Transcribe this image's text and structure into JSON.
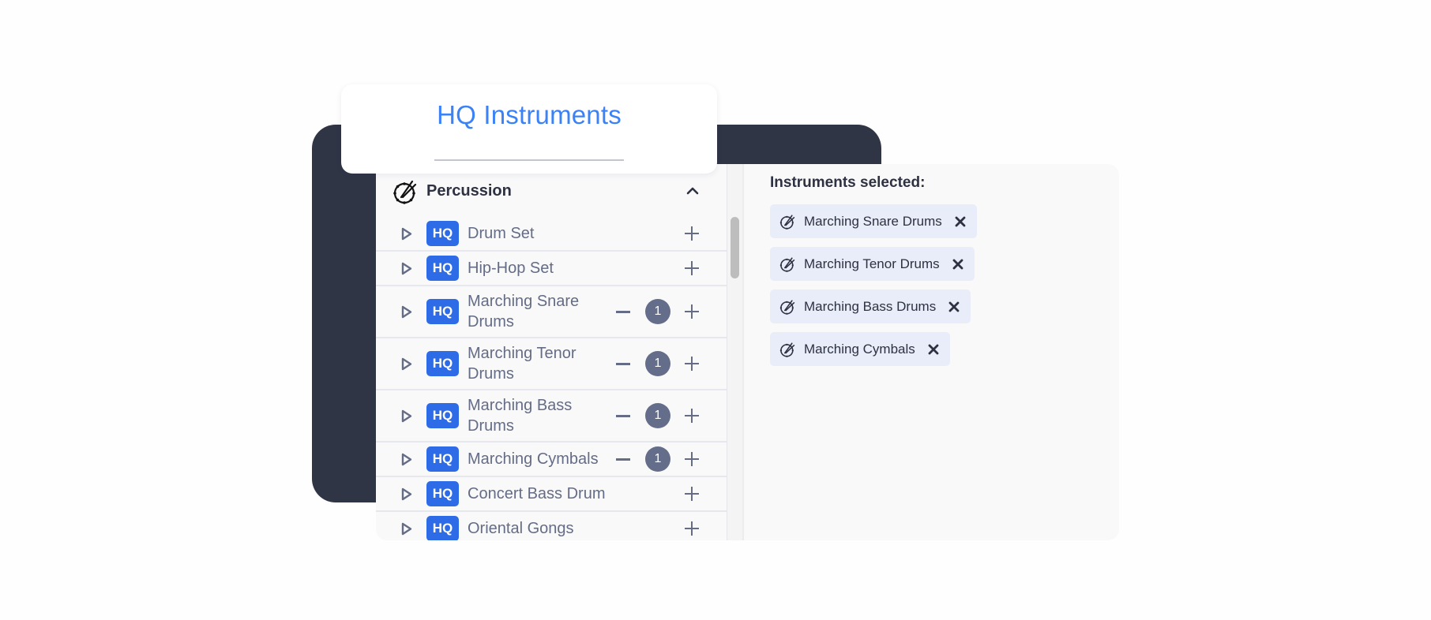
{
  "title_card": {
    "title": "HQ Instruments"
  },
  "category": {
    "label": "Percussion",
    "icon": "drum-icon",
    "expanded": true
  },
  "instruments": [
    {
      "badge": "HQ",
      "name": "Drum Set",
      "count": null,
      "lines": 1
    },
    {
      "badge": "HQ",
      "name": "Hip-Hop Set",
      "count": null,
      "lines": 1
    },
    {
      "badge": "HQ",
      "name": "Marching Snare Drums",
      "count": "1",
      "lines": 2
    },
    {
      "badge": "HQ",
      "name": "Marching Tenor Drums",
      "count": "1",
      "lines": 2
    },
    {
      "badge": "HQ",
      "name": "Marching Bass Drums",
      "count": "1",
      "lines": 2
    },
    {
      "badge": "HQ",
      "name": "Marching Cymbals",
      "count": "1",
      "lines": 1
    },
    {
      "badge": "HQ",
      "name": "Concert Bass Drum",
      "count": null,
      "lines": 1
    },
    {
      "badge": "HQ",
      "name": "Oriental Gongs",
      "count": null,
      "lines": 1
    }
  ],
  "selected": {
    "heading": "Instruments selected:",
    "items": [
      {
        "label": "Marching Snare Drums"
      },
      {
        "label": "Marching Tenor Drums"
      },
      {
        "label": "Marching Bass Drums"
      },
      {
        "label": "Marching Cymbals"
      }
    ]
  },
  "colors": {
    "accent": "#3b82f6",
    "hq_badge": "#2e6be6",
    "dark_bg": "#303546",
    "count_badge": "#646d89",
    "chip_bg": "#e8edf9"
  }
}
